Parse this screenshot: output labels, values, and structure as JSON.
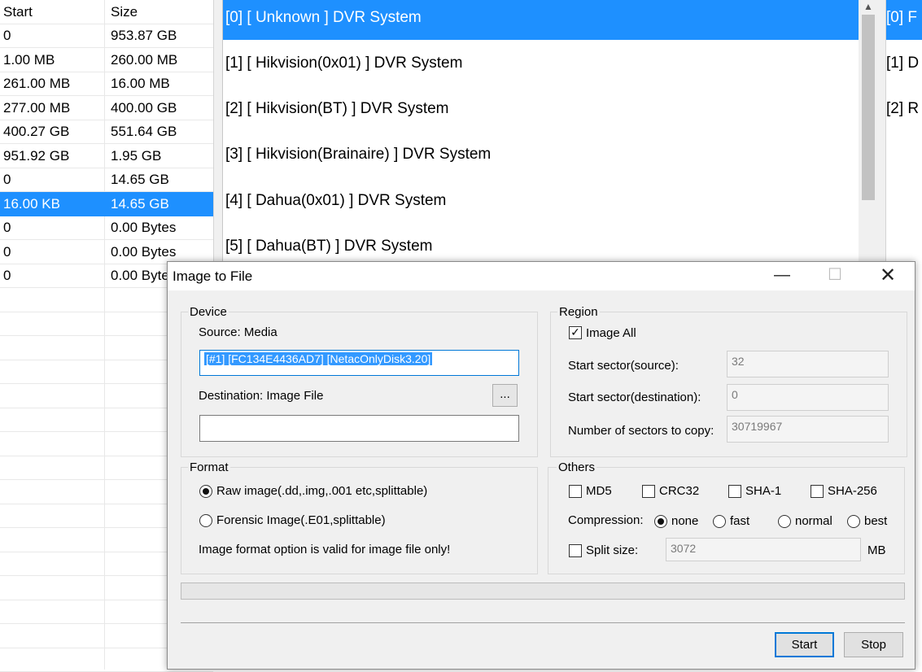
{
  "partition_table": {
    "columns": [
      "Start",
      "Size"
    ],
    "rows": [
      {
        "start": "0",
        "size": "953.87 GB"
      },
      {
        "start": "1.00 MB",
        "size": "260.00 MB"
      },
      {
        "start": "261.00 MB",
        "size": "16.00 MB"
      },
      {
        "start": "277.00 MB",
        "size": "400.00 GB"
      },
      {
        "start": "400.27 GB",
        "size": "551.64 GB"
      },
      {
        "start": "951.92 GB",
        "size": "1.95 GB"
      },
      {
        "start": "0",
        "size": "14.65 GB"
      },
      {
        "start": "16.00 KB",
        "size": "14.65 GB"
      },
      {
        "start": "0",
        "size": "0.00 Bytes"
      },
      {
        "start": "0",
        "size": "0.00 Bytes"
      },
      {
        "start": "0",
        "size": "0.00 Byte"
      }
    ],
    "selected_row_index": 7
  },
  "dvr_list": {
    "items": [
      "[0]  [ Unknown ] DVR System",
      "[1]  [ Hikvision(0x01) ] DVR System",
      "[2]  [ Hikvision(BT) ] DVR System",
      "[3]  [ Hikvision(Brainaire) ] DVR System",
      "[4]  [ Dahua(0x01) ] DVR System",
      "[5]  [ Dahua(BT) ] DVR System"
    ],
    "selected_index": 0
  },
  "right_list": {
    "items": [
      "[0]  F",
      "[1]  D",
      "[2]  R"
    ],
    "selected_index": 0
  },
  "dialog": {
    "title": "Image to File",
    "device": {
      "group_label": "Device",
      "source_label": "Source: Media",
      "source_value": "[#1] [FC134E4436AD7] [NetacOnlyDisk3.20]",
      "destination_label": "Destination: Image File",
      "browse_label": "...",
      "destination_value": ""
    },
    "region": {
      "group_label": "Region",
      "image_all_label": "Image All",
      "image_all_checked": true,
      "start_source_label": "Start sector(source):",
      "start_source_value": "32",
      "start_dest_label": "Start sector(destination):",
      "start_dest_value": "0",
      "num_sectors_label": "Number of sectors to copy:",
      "num_sectors_value": "30719967"
    },
    "format": {
      "group_label": "Format",
      "raw_label": "Raw image(.dd,.img,.001 etc,splittable)",
      "forensic_label": "Forensic Image(.E01,splittable)",
      "selected": "raw",
      "note": "Image format option is valid for image file only!"
    },
    "others": {
      "group_label": "Others",
      "md5_label": "MD5",
      "crc32_label": "CRC32",
      "sha1_label": "SHA-1",
      "sha256_label": "SHA-256",
      "compression_label": "Compression:",
      "compression_none": "none",
      "compression_fast": "fast",
      "compression_normal": "normal",
      "compression_best": "best",
      "compression_selected": "none",
      "split_label": "Split size:",
      "split_value": "3072",
      "split_unit": "MB"
    },
    "buttons": {
      "start": "Start",
      "stop": "Stop"
    },
    "progress": 0
  }
}
